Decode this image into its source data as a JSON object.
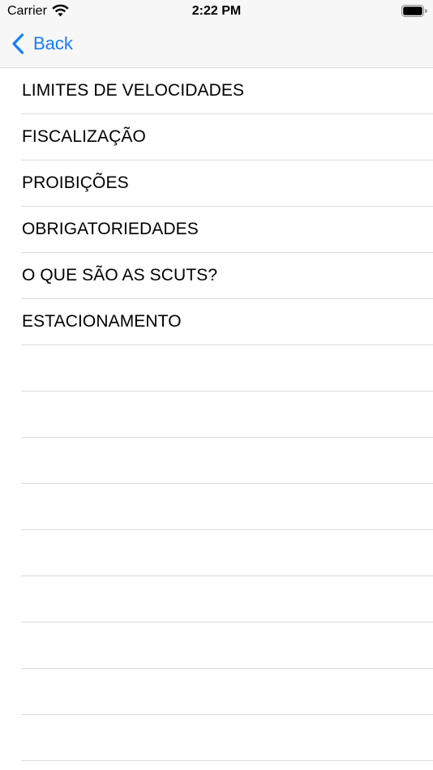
{
  "status_bar": {
    "carrier": "Carrier",
    "time": "2:22 PM",
    "wifi_icon": "wifi-icon",
    "battery_icon": "battery-icon"
  },
  "nav": {
    "back_label": "Back",
    "back_icon": "chevron-left-icon",
    "tint_color": "#157efb"
  },
  "menu": {
    "items": [
      {
        "label": "LIMITES DE VELOCIDADES"
      },
      {
        "label": "FISCALIZAÇÃO"
      },
      {
        "label": "PROIBIÇÕES"
      },
      {
        "label": "OBRIGATORIEDADES"
      },
      {
        "label": "O QUE SÃO AS SCUTS?"
      },
      {
        "label": "ESTACIONAMENTO"
      }
    ]
  }
}
